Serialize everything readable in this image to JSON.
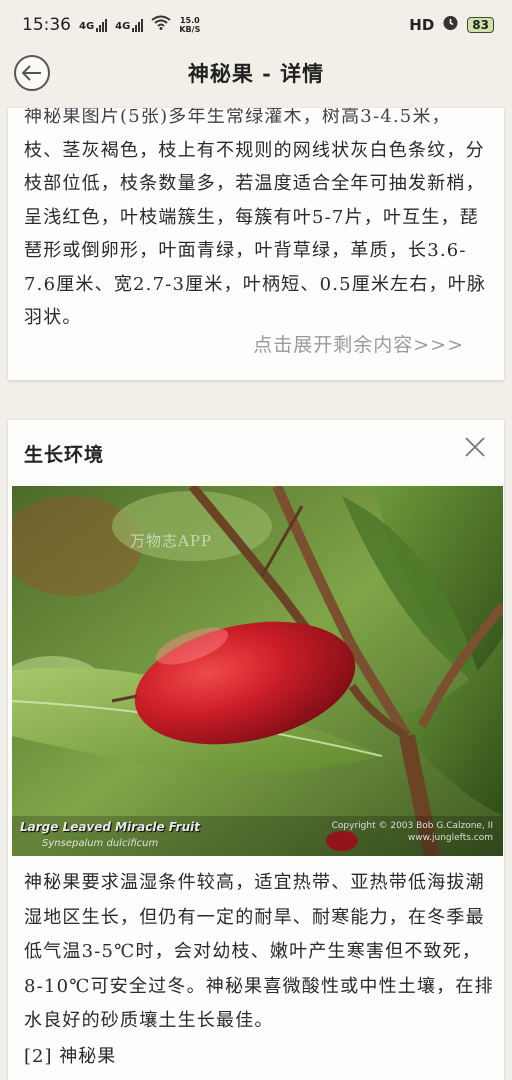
{
  "status_bar": {
    "time": "15:36",
    "network_1": "4G",
    "network_2": "4G",
    "speed_value": "15.0",
    "speed_unit": "KB/S",
    "hd_label": "HD",
    "battery": "83"
  },
  "header": {
    "title": "神秘果 - 详情",
    "back_icon": "back-arrow-icon"
  },
  "intro_card": {
    "partial_line": "神秘果图片(5张)多年生常绿灌木，树高3-4.5米，",
    "paragraph": "枝、茎灰褐色，枝上有不规则的网线状灰白色条纹，分枝部位低，枝条数量多，若温度适合全年可抽发新梢，呈浅红色，叶枝端簇生，每簇有叶5-7片，叶互生，琵琶形或倒卵形，叶面青绿，叶背草绿，革质，长3.6-7.6厘米、宽2.7-3厘米，叶柄短、0.5厘米左右，叶脉羽状。",
    "expand_label": "点击展开剩余内容>>>"
  },
  "environment_card": {
    "title": "生长环境",
    "close_icon": "close-icon",
    "image": {
      "watermark": "万物志APP",
      "caption": "Large Leaved Miracle Fruit",
      "caption_latin": "Synsepalum dulcificum",
      "copyright": "Copyright © 2003 Bob G.Calzone, II",
      "site": "www.junglefts.com"
    },
    "paragraph": "神秘果要求温湿条件较高，适宜热带、亚热带低海拔潮湿地区生长，但仍有一定的耐旱、耐寒能力，在冬季最低气温3-5℃时，会对幼枝、嫩叶产生寒害但不致死，8-10℃可安全过冬。神秘果喜微酸性或中性土壤，在排水良好的砂质壤土生长最佳。",
    "reference": "[2] 神秘果"
  },
  "colors": {
    "background": "#f1efe8",
    "card": "#fdfdfb",
    "link_gray": "#9a9a9a",
    "fruit_red": "#c8202a",
    "leaf_green": "#6f9a3a"
  }
}
